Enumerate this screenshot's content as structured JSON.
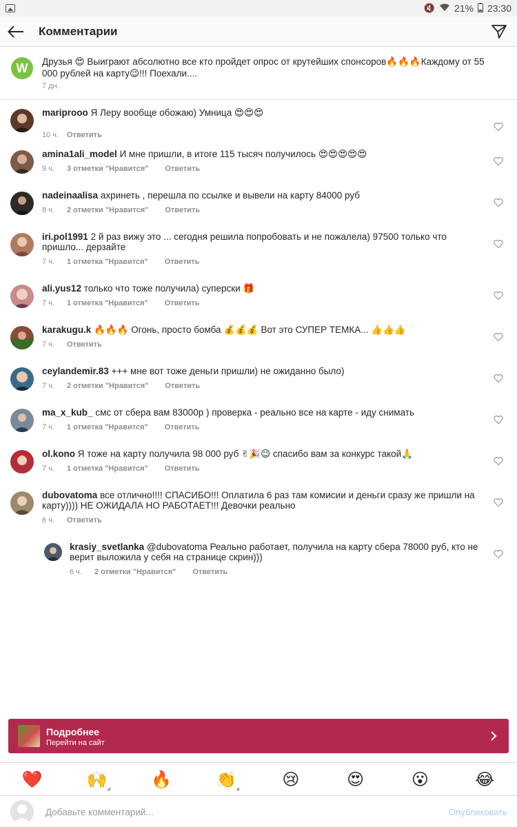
{
  "status_bar": {
    "battery": "21%",
    "time": "23:30"
  },
  "header": {
    "title": "Комментарии"
  },
  "caption": {
    "avatar_letter": "W",
    "text": "Друзья 😍 Выиграют абсолютно все кто пройдет опрос от крутейших спонсоров🔥🔥🔥Каждому от 55 000 рублей на карту😉!!! Поехали....",
    "time": "7 дн."
  },
  "comments": [
    {
      "username": "mariprooo",
      "text": "Я Леру вообще обожаю) Умница 😍😍😍",
      "time": "10 ч.",
      "likes": "",
      "reply": "Ответить",
      "avatar_color": "#5a3a2a"
    },
    {
      "username": "amina1ali_model",
      "text": "И мне пришли, в итоге 115 тысяч получилось 😍😍😍😍😍",
      "time": "9 ч.",
      "likes": "3 отметки \"Нравится\"",
      "reply": "Ответить",
      "avatar_color": "#7a5a48"
    },
    {
      "username": "nadeinaalisa",
      "text": "ахринеть , перешла по ссылке и вывели на карту 84000 руб",
      "time": "8 ч.",
      "likes": "2 отметки \"Нравится\"",
      "reply": "Ответить",
      "avatar_color": "#2e2a28"
    },
    {
      "username": "iri.pol1991",
      "text": "2 й раз вижу это ... сегодня решила попробовать и не пожалела) 97500 только что пришло... дерзайте",
      "time": "7 ч.",
      "likes": "1 отметка \"Нравится\"",
      "reply": "Ответить",
      "avatar_color": "#b07a60"
    },
    {
      "username": "ali.yus12",
      "text": "только что тоже получила) суперски 🎁",
      "time": "7 ч.",
      "likes": "1 отметка \"Нравится\"",
      "reply": "Ответить",
      "avatar_color": "#c98a8a"
    },
    {
      "username": "karakugu.k",
      "text": "🔥🔥🔥 Огонь, просто бомба 💰💰💰 Вот это СУПЕР ТЕМКА... 👍👍👍",
      "time": "7 ч.",
      "likes": "",
      "reply": "Ответить",
      "avatar_color": "#8a4a3a"
    },
    {
      "username": "ceylandemir.83",
      "text": "+++ мне вот тоже деньги пришли) не ожиданно было)",
      "time": "7 ч.",
      "likes": "2 отметки \"Нравится\"",
      "reply": "Ответить",
      "avatar_color": "#3a6a8a"
    },
    {
      "username": "ma_x_kub_",
      "text": "смс от сбера вам 83000р ) проверка - реально все на карте - иду снимать",
      "time": "7 ч.",
      "likes": "1 отметка \"Нравится\"",
      "reply": "Ответить",
      "avatar_color": "#7a8a9a"
    },
    {
      "username": "ol.kono",
      "text": "Я тоже на карту получила 98 000 руб ✌🎉😉 спасибо вам за конкурс такой🙏",
      "time": "7 ч.",
      "likes": "1 отметка \"Нравится\"",
      "reply": "Ответить",
      "avatar_color": "#b0303a"
    },
    {
      "username": "dubovatoma",
      "text": "все отлично!!!! СПАСИБО!!! Оплатила 6 раз там комисии и деньги сразу же пришли на карту)))) НЕ ОЖИДАЛА НО РАБОТАЕТ!!! Девочки реально",
      "time": "6 ч.",
      "likes": "",
      "reply": "Ответить",
      "avatar_color": "#9a8a6a"
    }
  ],
  "reply_comment": {
    "username": "krasiy_svetlanka",
    "mention": "@dubovatoma",
    "text": "Реально работает, получила на карту сбера 78000 руб, кто не верит выложила у себя на странице скрин)))",
    "time": "6 ч.",
    "likes": "2 отметки \"Нравится\"",
    "reply": "Ответить",
    "avatar_color": "#4a5a6a"
  },
  "cta": {
    "title": "Подробнее",
    "subtitle": "Перейти на сайт",
    "color": "#b3294e"
  },
  "emoji_bar": [
    {
      "glyph": "❤️",
      "name": "heart"
    },
    {
      "glyph": "🙌",
      "name": "raised-hands"
    },
    {
      "glyph": "🔥",
      "name": "fire"
    },
    {
      "glyph": "👏",
      "name": "clap"
    },
    {
      "glyph": "😢",
      "name": "crying-face"
    },
    {
      "glyph": "😍",
      "name": "heart-eyes"
    },
    {
      "glyph": "😮",
      "name": "surprised-face"
    },
    {
      "glyph": "😂",
      "name": "laughing-face"
    }
  ],
  "comment_input": {
    "placeholder": "Добавьте комментарий...",
    "publish_label": "Опубликовать"
  }
}
